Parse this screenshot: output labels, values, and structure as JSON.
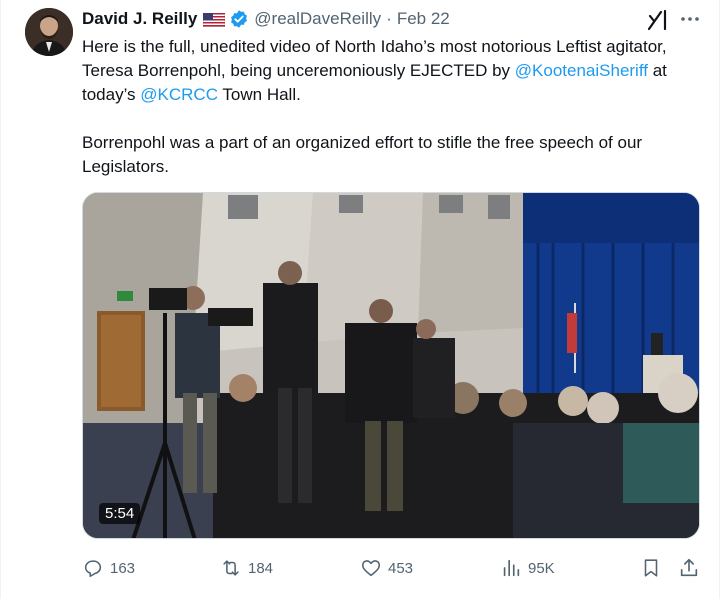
{
  "author": {
    "display_name": "David J. Reilly",
    "handle": "@realDaveReilly",
    "separator": "·",
    "date": "Feb 22"
  },
  "tweet": {
    "line1_text_a": "Here is the full, unedited video of North Idaho’s most notorious Leftist agitator, Teresa Borrenpohl, being unceremoniously EJECTED by ",
    "mention1": "@KootenaiSheriff",
    "line1_text_b": " at today’s ",
    "mention2": "@KCRCC",
    "line1_text_c": " Town Hall.",
    "paragraph2": "Borrenpohl was a part of an organized effort to stifle the free speech of our Legislators."
  },
  "media": {
    "duration": "5:54"
  },
  "actions": {
    "replies": "163",
    "reposts": "184",
    "likes": "453",
    "views": "95K"
  },
  "colors": {
    "link": "#1d9bf0",
    "muted": "#536471",
    "verified": "#1d9bf0"
  },
  "icons": [
    "grok-icon",
    "more-icon",
    "reply-icon",
    "repost-icon",
    "like-icon",
    "views-icon",
    "bookmark-icon",
    "share-icon",
    "verified-icon",
    "us-flag-icon"
  ]
}
